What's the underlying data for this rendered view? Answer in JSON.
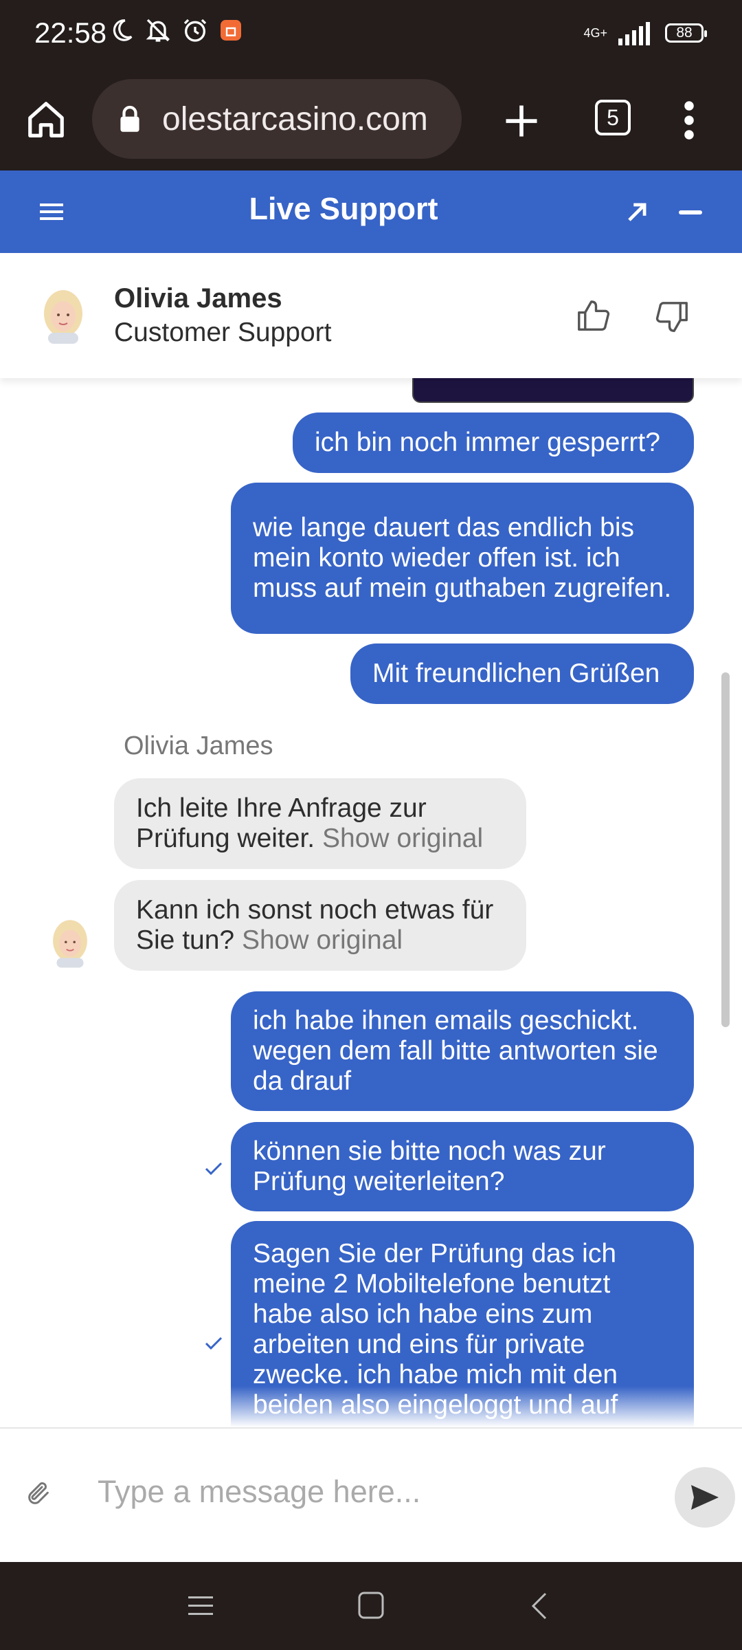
{
  "status_bar": {
    "time": "22:58",
    "network": "4G+",
    "battery": "88"
  },
  "browser": {
    "url": "olestarcasino.com",
    "tab_count": "5"
  },
  "chat_header": {
    "title": "Live Support"
  },
  "agent": {
    "name": "Olivia James",
    "role": "Customer Support"
  },
  "messages": [
    {
      "from": "user",
      "text": "ich bin noch immer gesperrt?"
    },
    {
      "from": "user",
      "text": "wie lange dauert das endlich bis mein konto wieder offen ist. ich muss auf mein guthaben zugreifen."
    },
    {
      "from": "user",
      "text": "Mit freundlichen Grüßen"
    },
    {
      "from": "agent",
      "sender": "Olivia James",
      "text": "Ich leite Ihre Anfrage zur Prüfung weiter.",
      "link": "Show original"
    },
    {
      "from": "agent",
      "text": "Kann ich sonst noch etwas für Sie tun?",
      "link": "Show original"
    },
    {
      "from": "user",
      "text": "ich habe ihnen emails geschickt. wegen dem fall bitte antworten sie da drauf"
    },
    {
      "from": "user",
      "text": "können sie bitte noch was zur Prüfung weiterleiten?",
      "status": "sent"
    },
    {
      "from": "user",
      "text": "Sagen Sie der Prüfung das ich meine 2 Mobiltelefone benutzt habe also ich habe eins zum arbeiten und eins für private zwecke. ich habe mich mit den beiden also eingeloggt und auf",
      "status": "sent"
    }
  ],
  "composer": {
    "placeholder": "Type a message here..."
  },
  "colors": {
    "accent": "#3764c7",
    "system_bar": "#241d1c",
    "incoming_bubble": "#ebebeb"
  }
}
